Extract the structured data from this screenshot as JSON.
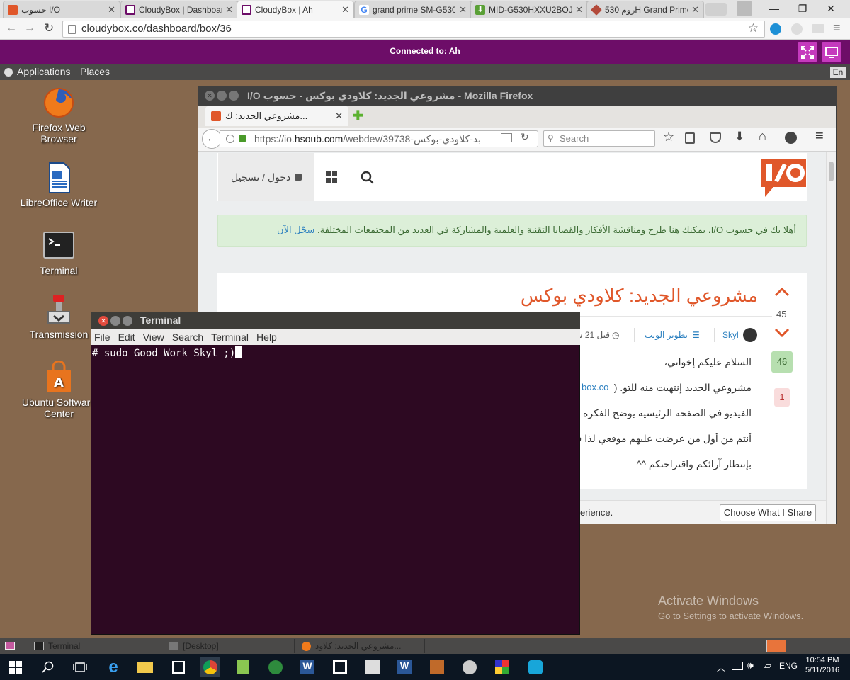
{
  "chrome": {
    "tabs": [
      {
        "label": "حسوب I/O",
        "favicon": "hsoub"
      },
      {
        "label": "CloudyBox | Dashboard",
        "favicon": "cloudybox"
      },
      {
        "label": "CloudyBox | Ah",
        "favicon": "cloudybox",
        "active": true
      },
      {
        "label": "grand prime SM-G530",
        "favicon": "google"
      },
      {
        "label": "MID-G530HXXU2BOJ3",
        "favicon": "download"
      },
      {
        "label": "روم 530H Grand Prime",
        "favicon": "gem"
      }
    ],
    "url": "cloudybox.co/dashboard/box/36"
  },
  "remote": {
    "status": "Connected to: Ah"
  },
  "gnome": {
    "applications": "Applications",
    "places": "Places",
    "lang": "En",
    "bottom_tasks": [
      "Terminal",
      "[Desktop]",
      "مشروعي الجديد: كلاود..."
    ]
  },
  "desktop": {
    "icons": [
      "Firefox Web Browser",
      "LibreOffice Writer",
      "Terminal",
      "Transmission",
      "Ubuntu Software Center"
    ]
  },
  "firefox": {
    "window_title": "I/O مشروعي الجديد: كلاودي بوكس - حسوب - Mozilla Firefox",
    "tab_label": "مشروعي الجديد: ك...",
    "url_prefix": "https://io.",
    "url_domain": "hsoub.com",
    "url_path": "/webdev/39738-بد-كلاودي-بوكس",
    "search_placeholder": "Search",
    "site": {
      "login": "دخول / تسجيل",
      "notice": "أهلا بك في حسوب I/O، يمكنك هنا طرح ومناقشة الأفكار والقضايا التقنية والعلمية والمشاركة في العديد من المجتمعات المختلفة.",
      "notice_link": "سجّل الآن",
      "post": {
        "title": "مشروعي الجديد: كلاودي بوكس",
        "votes": "45",
        "author": "Skyl",
        "category": "تطوير الويب",
        "time": "قبل 21 س",
        "comments_badge": "46",
        "pin_badge": "1",
        "lines": [
          "السلام عليكم إخواني،",
          "مشروعي الجديد إنتهيت منه للتو. (",
          "الفيديو في الصفحة الرئيسية يوضح الفكرة",
          "أنتم من أول من عرضت عليهم موقعي لذا ف",
          "بإنتظار آرائكم واقتراحتكم ^^"
        ],
        "link_fragment": "box.co"
      },
      "cookie_text": "erience.",
      "cookie_button": "Choose What I Share"
    }
  },
  "terminal": {
    "title": "Terminal",
    "menu": [
      "File",
      "Edit",
      "View",
      "Search",
      "Terminal",
      "Help"
    ],
    "line": "# sudo Good Work Skyl ;)"
  },
  "watermark": {
    "title": "Activate Windows",
    "subtitle": "Go to Settings to activate Windows."
  },
  "tray": {
    "lang": "ENG",
    "time": "10:54 PM",
    "date": "5/11/2016"
  },
  "colors": {
    "remote_bar": "#6d0d68",
    "terminal_bg": "#2d0922",
    "hsoub_orange": "#e0572a",
    "desktop": "#86684d"
  }
}
